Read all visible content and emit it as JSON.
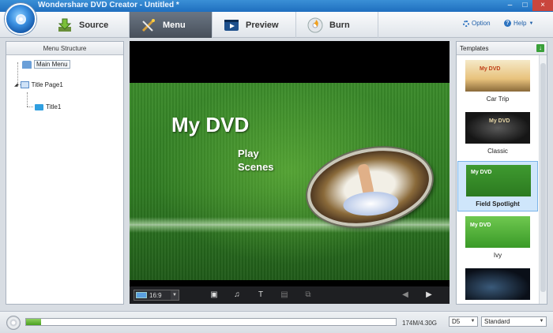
{
  "window": {
    "title": "Wondershare DVD Creator - Untitled *",
    "controls": [
      "–",
      "□",
      "×"
    ]
  },
  "toolbar": {
    "tabs": [
      {
        "label": "Source",
        "icon": "download-arrow-icon"
      },
      {
        "label": "Menu",
        "icon": "wand-icon",
        "active": true
      },
      {
        "label": "Preview",
        "icon": "film-play-icon"
      },
      {
        "label": "Burn",
        "icon": "disc-burn-icon"
      }
    ],
    "option_label": "Option",
    "help_label": "Help"
  },
  "menu_structure": {
    "header": "Menu Structure",
    "nodes": [
      {
        "label": "Main Menu",
        "icon": "home-icon"
      },
      {
        "label": "Title Page1",
        "icon": "page-icon"
      },
      {
        "label": "Title1",
        "icon": "folder-icon"
      }
    ]
  },
  "preview": {
    "title_text": "My DVD",
    "play_text": "Play",
    "scenes_text": "Scenes",
    "aspect_ratio": "16:9"
  },
  "templates": {
    "header": "Templates",
    "items": [
      {
        "name": "Car Trip",
        "thumb_text": "My DVD"
      },
      {
        "name": "Classic",
        "thumb_text": "My DVD"
      },
      {
        "name": "Field Spotlight",
        "thumb_text": "My DVD",
        "selected": true
      },
      {
        "name": "Ivy",
        "thumb_text": "My DVD"
      },
      {
        "name": "",
        "thumb_text": ""
      }
    ]
  },
  "status": {
    "capacity": "174M/4.30G",
    "disc_type": "D5",
    "quality": "Standard",
    "progress_fraction": 0.04
  },
  "colors": {
    "accent": "#2d73c0",
    "selected_bg": "#cfe6fb"
  }
}
